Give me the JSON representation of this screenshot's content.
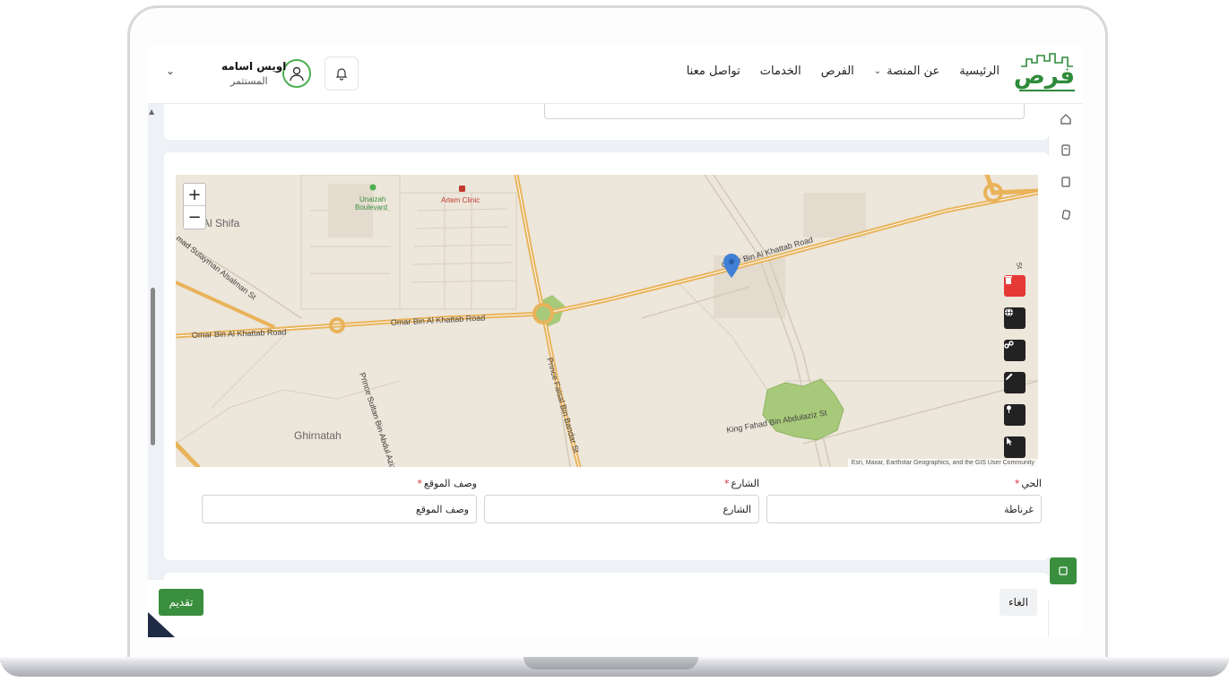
{
  "header": {
    "logo_text": "فرص",
    "nav": [
      {
        "label": "الرئيسية",
        "has_dropdown": false
      },
      {
        "label": "عن المنصة",
        "has_dropdown": true
      },
      {
        "label": "الفرص",
        "has_dropdown": false
      },
      {
        "label": "الخدمات",
        "has_dropdown": false
      },
      {
        "label": "تواصل معنا",
        "has_dropdown": false
      }
    ],
    "user": {
      "name": "اويس اسامه",
      "role": "المستثمر"
    },
    "icons": {
      "bell": "bell-icon",
      "avatar": "user-avatar-icon",
      "menu": "chevron-down-icon"
    }
  },
  "map": {
    "labels": {
      "road_main_1": "Omar Bin Al Khattab Road",
      "road_main_2": "Omar Bin Al Khattab Road",
      "road_main_3": "Omar Bin Al Khattab Road",
      "road_prince_sultan": "Prince Sultan Bin Abdul Aziz St",
      "road_prince_faisal": "Prince Faisal Bin Bandar St",
      "road_king_fahad": "King Fahad Bin Abdulaziz St",
      "road_sulayman": "mad Sulayman Alsalman St",
      "place_unaizah": "Unaizah",
      "place_boulevard": "Boulevard",
      "place_clinic": "Artem Clinic",
      "place_shifa": "Al Shifa",
      "place_ghirnatah": "Ghirnatah",
      "road_st_right": "St"
    },
    "zoom_in": "+",
    "zoom_out": "−",
    "attribution": "Esri, Maxar, Earthstar Geographics, and the GIS User Community",
    "tools": [
      "trash-icon",
      "globe-icon",
      "link-icon",
      "pencil-icon",
      "pin-icon",
      "cursor-icon"
    ],
    "colors": {
      "delete": "#e53935",
      "tool": "#222222",
      "road": "#e9b35a",
      "park": "#a7c97a",
      "pin": "#3f7fd6"
    }
  },
  "form": {
    "district": {
      "label": "الحي",
      "value": "غرناطة"
    },
    "street": {
      "label": "الشارع",
      "value": "",
      "placeholder": "الشارع"
    },
    "description": {
      "label": "وصف الموقع",
      "value": "",
      "placeholder": "وصف الموقع"
    }
  },
  "footer": {
    "cancel": "الغاء",
    "submit": "تقديم"
  }
}
